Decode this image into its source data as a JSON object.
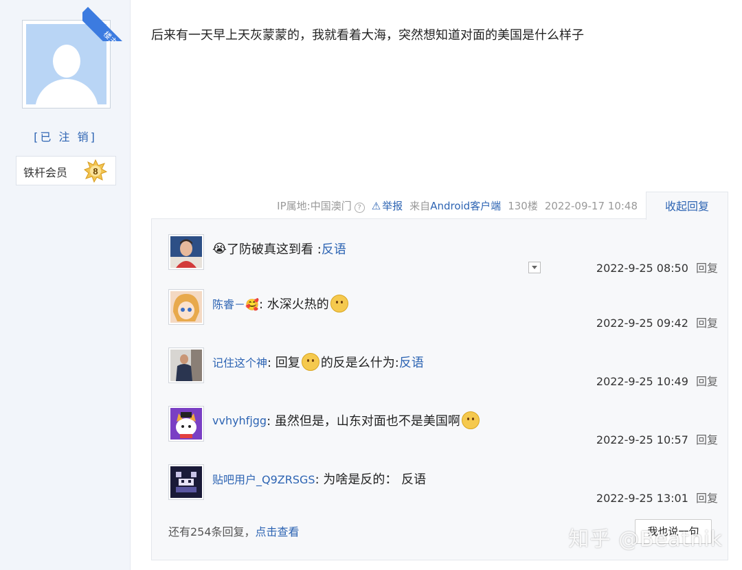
{
  "author": {
    "badge": "楼主",
    "username": "[已 注 销]",
    "member_label": "铁杆会员",
    "level": "8"
  },
  "post": {
    "content": "后来有一天早上天灰蒙蒙的，我就看着大海，突然想知道对面的美国是什么样子",
    "ip": "IP属地:中国澳门",
    "report": "举报",
    "client_prefix": "来自",
    "client": "Android客户端",
    "floor": "130楼",
    "time": "2022-09-17 10:48",
    "collapse_label": "收起回复"
  },
  "replies": [
    {
      "name": "",
      "prefix_emoji": "😭",
      "text": "了防破真这到看 : ",
      "tail": "反语",
      "time": "2022-9-25 08:50",
      "reply": "回复"
    },
    {
      "name": "陈睿－🥰",
      "text": ": 水深火热的",
      "time": "2022-9-25 09:42",
      "reply": "回复"
    },
    {
      "name": "记住这个神",
      "text_a": ": 回复 ",
      "text_b": "的反是么什为: ",
      "tail": "反语",
      "time": "2022-9-25 10:49",
      "reply": "回复"
    },
    {
      "name": "vvhyhfjgg",
      "text": ": 虽然但是，山东对面也不是美国啊",
      "time": "2022-9-25 10:57",
      "reply": "回复"
    },
    {
      "name": "贴吧用户_Q9ZRSGS",
      "text": ": 为啥是反的：  反语",
      "time": "2022-9-25 13:01",
      "reply": "回复"
    }
  ],
  "footer": {
    "more_prefix": "还有254条回复，",
    "more_link": "点击查看",
    "say_button": "我也说一句"
  },
  "watermark": "知乎 @Beatnik",
  "colors": {
    "link": "#2d64b3",
    "sidebar_bg": "#f2f5fa",
    "reply_bg": "#f7f8fa",
    "badge_blue": "#3c7be0"
  }
}
